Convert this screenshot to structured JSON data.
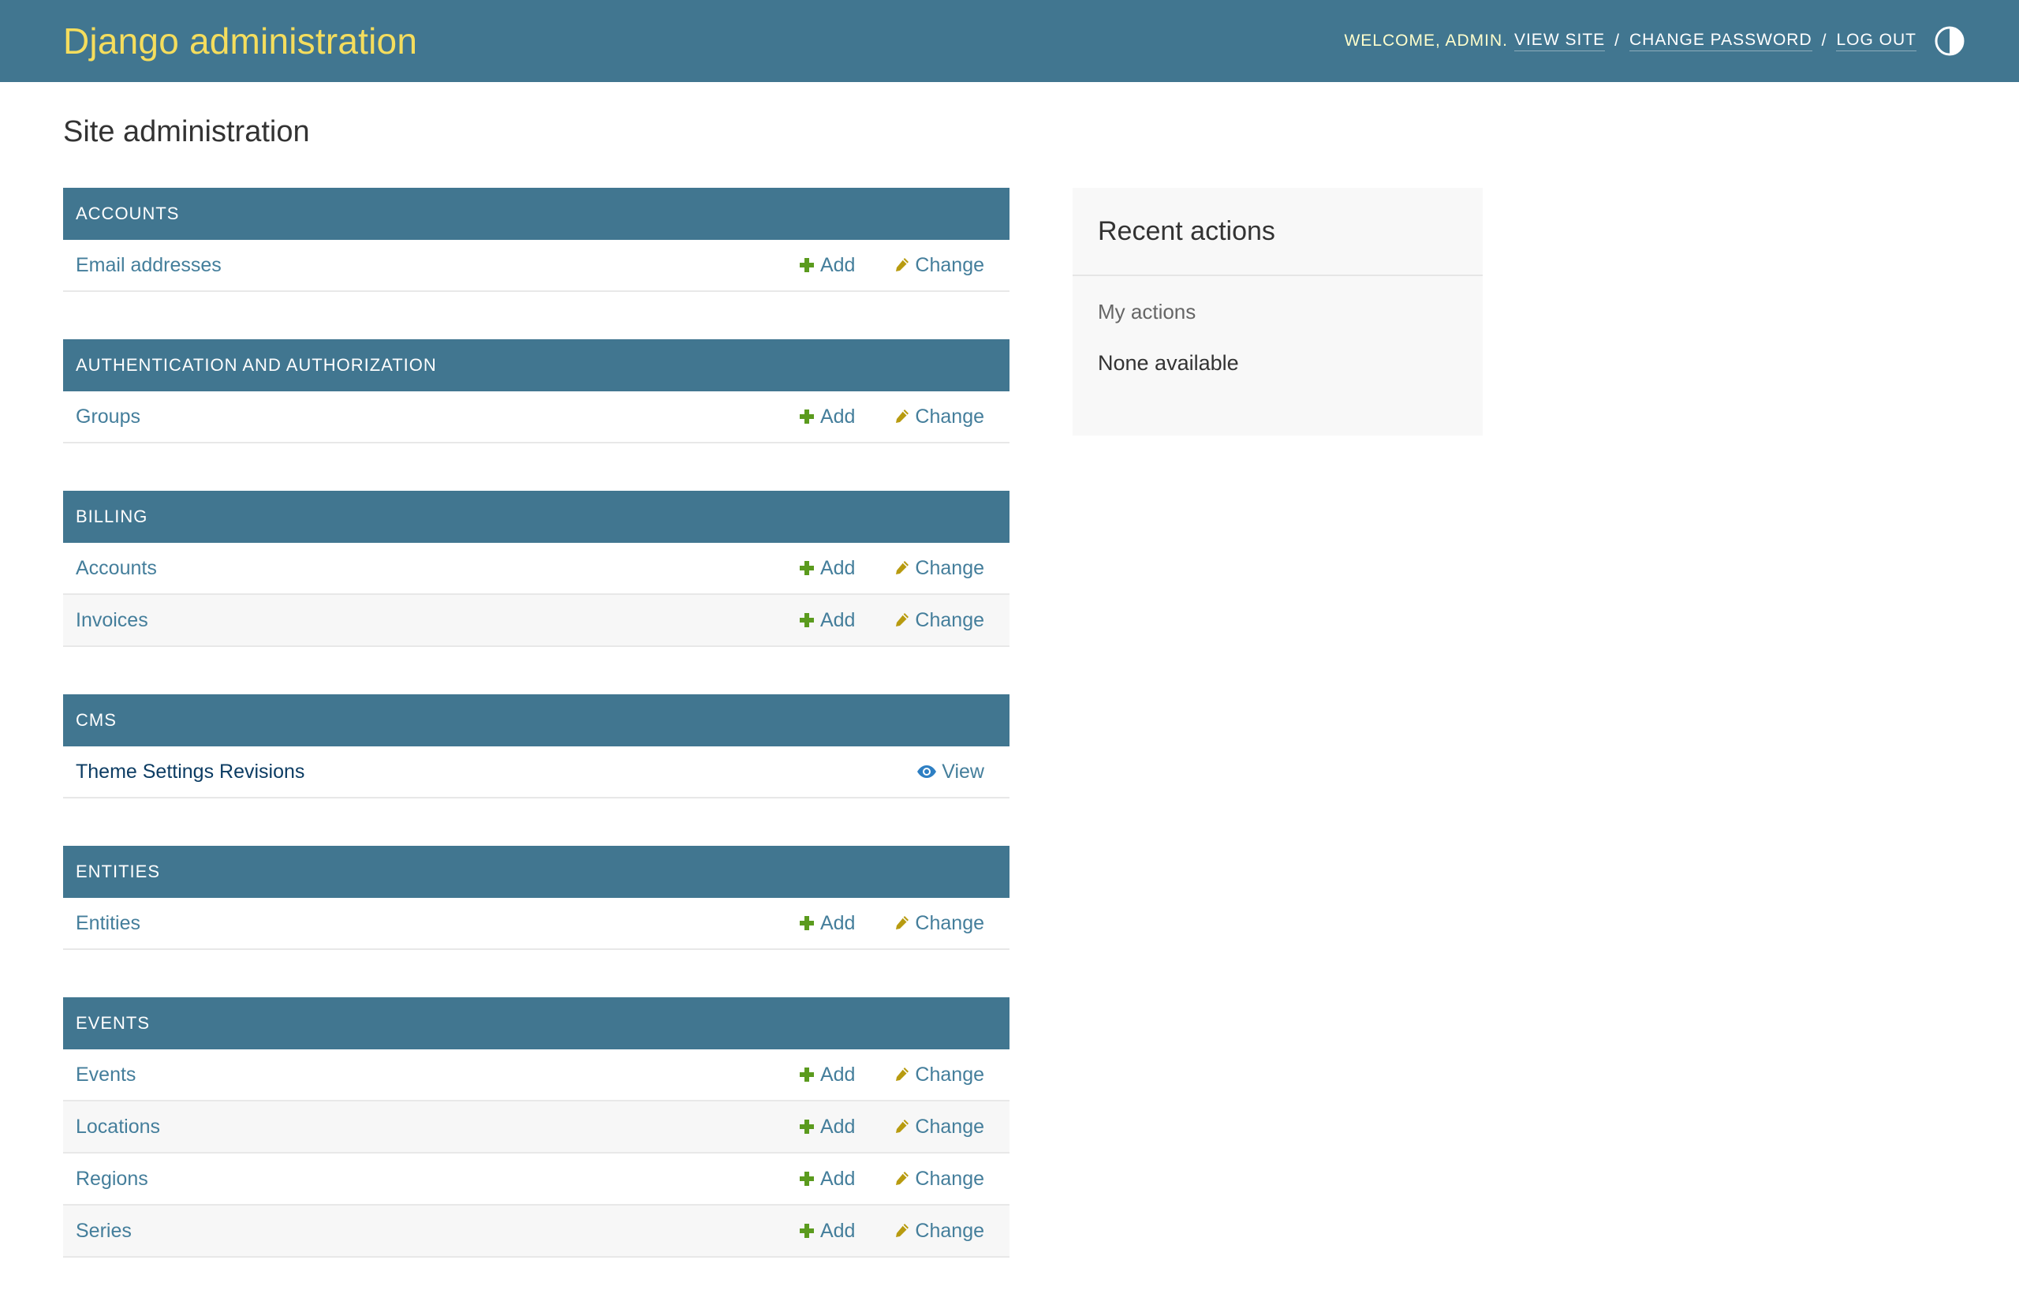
{
  "header": {
    "brand": "Django administration",
    "welcome": "WELCOME, ADMIN.",
    "links": {
      "view_site": "VIEW SITE",
      "change_password": "CHANGE PASSWORD",
      "log_out": "LOG OUT"
    },
    "separator": "/",
    "theme_toggle_icon": "half-circle-icon",
    "brand_color": "#f5dd5d",
    "bar_color": "#417690"
  },
  "page_title": "Site administration",
  "labels": {
    "add": "Add",
    "change": "Change",
    "view": "View"
  },
  "modules": [
    {
      "caption": "ACCOUNTS",
      "models": [
        {
          "name": "Email addresses",
          "actions": [
            "add",
            "change"
          ]
        }
      ]
    },
    {
      "caption": "AUTHENTICATION AND AUTHORIZATION",
      "models": [
        {
          "name": "Groups",
          "actions": [
            "add",
            "change"
          ]
        }
      ]
    },
    {
      "caption": "BILLING",
      "models": [
        {
          "name": "Accounts",
          "actions": [
            "add",
            "change"
          ]
        },
        {
          "name": "Invoices",
          "actions": [
            "add",
            "change"
          ]
        }
      ]
    },
    {
      "caption": "CMS",
      "models": [
        {
          "name": "Theme Settings Revisions",
          "actions": [
            "view"
          ]
        }
      ]
    },
    {
      "caption": "ENTITIES",
      "models": [
        {
          "name": "Entities",
          "actions": [
            "add",
            "change"
          ]
        }
      ]
    },
    {
      "caption": "EVENTS",
      "models": [
        {
          "name": "Events",
          "actions": [
            "add",
            "change"
          ]
        },
        {
          "name": "Locations",
          "actions": [
            "add",
            "change"
          ]
        },
        {
          "name": "Regions",
          "actions": [
            "add",
            "change"
          ]
        },
        {
          "name": "Series",
          "actions": [
            "add",
            "change"
          ]
        }
      ]
    }
  ],
  "recent_actions": {
    "title": "Recent actions",
    "subtitle": "My actions",
    "empty_text": "None available"
  },
  "icons": {
    "add": "plus-icon",
    "change": "pencil-icon",
    "view": "eye-icon"
  },
  "colors": {
    "add_icon": "#5b9b1e",
    "change_icon": "#b89b10",
    "view_icon": "#2e7fc3",
    "link": "#447e9b"
  }
}
